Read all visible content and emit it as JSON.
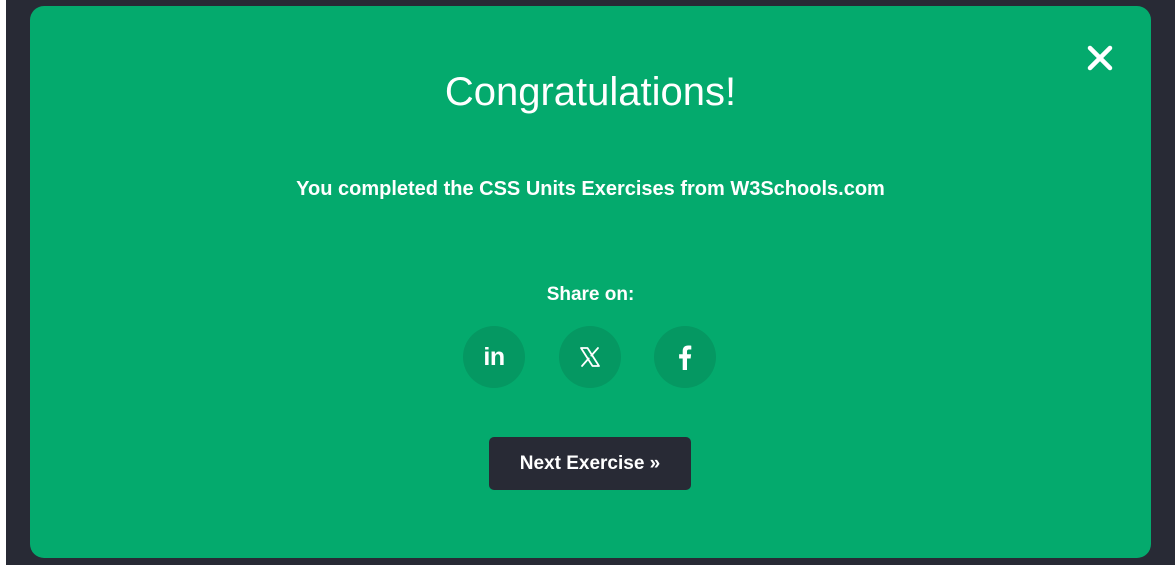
{
  "modal": {
    "title": "Congratulations!",
    "message": "You completed the CSS Units Exercises from W3Schools.com",
    "share_label": "Share on:",
    "share_buttons": [
      {
        "network": "LinkedIn",
        "icon": "linkedin-icon",
        "glyph": "in"
      },
      {
        "network": "X",
        "icon": "x-icon"
      },
      {
        "network": "Facebook",
        "icon": "facebook-icon"
      }
    ],
    "next_button_label": "Next Exercise »",
    "close_icon": "close-icon"
  },
  "colors": {
    "modal_background": "#04aa6d",
    "share_button_background": "#059862",
    "backdrop": "#282a35",
    "next_button_background": "#282a35",
    "text": "#ffffff"
  }
}
